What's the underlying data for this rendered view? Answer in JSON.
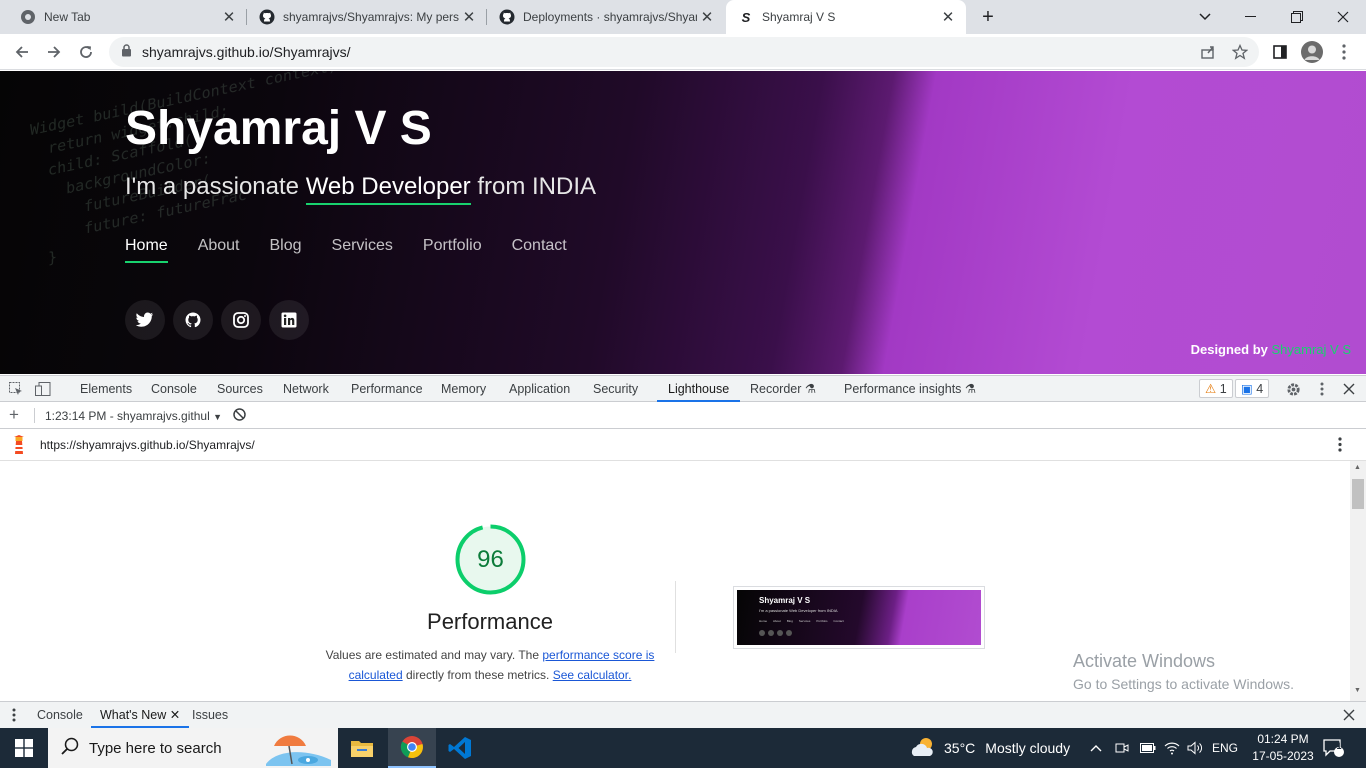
{
  "browser": {
    "tabs": [
      {
        "title": "New Tab",
        "icon": "chrome-icon",
        "active": false
      },
      {
        "title": "shyamrajvs/Shyamrajvs: My perso",
        "icon": "github-icon",
        "active": false
      },
      {
        "title": "Deployments · shyamrajvs/Shyam",
        "icon": "github-icon",
        "active": false
      },
      {
        "title": "Shyamraj V S",
        "icon": "site-icon",
        "active": true
      }
    ],
    "new_tab": "+",
    "url": "shyamrajvs.github.io/Shyamrajvs/"
  },
  "hero": {
    "name": "Shyamraj V S",
    "sub_prefix": "I'm a passionate ",
    "sub_highlight": "Web Developer",
    "sub_suffix": " from INDIA",
    "nav": [
      "Home",
      "About",
      "Blog",
      "Services",
      "Portfolio",
      "Contact"
    ],
    "nav_active": "Home",
    "socials": [
      "twitter-icon",
      "github-icon",
      "instagram-icon",
      "linkedin-icon"
    ],
    "designed_by_label": "Designed by",
    "designed_by_name": "Shyamraj V S",
    "accent_color": "#18d26e"
  },
  "devtools": {
    "tabs": [
      "Elements",
      "Console",
      "Sources",
      "Network",
      "Performance",
      "Memory",
      "Application",
      "Security",
      "Lighthouse",
      "Recorder",
      "Performance insights"
    ],
    "active_tab": "Lighthouse",
    "warnings": "1",
    "messages": "4",
    "report_selector": "1:23:14 PM - shyamrajvs.githul",
    "report_url": "https://shyamrajvs.github.io/Shyamrajvs/",
    "score": "96",
    "score_fraction": 0.96,
    "category": "Performance",
    "desc_prefix": "Values are estimated and may vary. The ",
    "desc_link1": "performance score is calculated",
    "desc_middle": " directly from these metrics. ",
    "desc_link2": "See calculator.",
    "thumb": {
      "name": "Shyamraj V S",
      "sub": "I'm a passionate Web Developer from INDIA",
      "nav": [
        "Home",
        "About",
        "Blog",
        "Services",
        "Portfolio",
        "Contact"
      ]
    },
    "drawer_tabs": [
      "Console",
      "What's New",
      "Issues"
    ],
    "drawer_active": "What's New"
  },
  "watermark": {
    "line1": "Activate Windows",
    "line2": "Go to Settings to activate Windows."
  },
  "taskbar": {
    "search_placeholder": "Type here to search",
    "weather_temp": "35°C",
    "weather_desc": "Mostly cloudy",
    "lang": "ENG",
    "time": "01:24 PM",
    "date": "17-05-2023",
    "notification_count": "1"
  }
}
